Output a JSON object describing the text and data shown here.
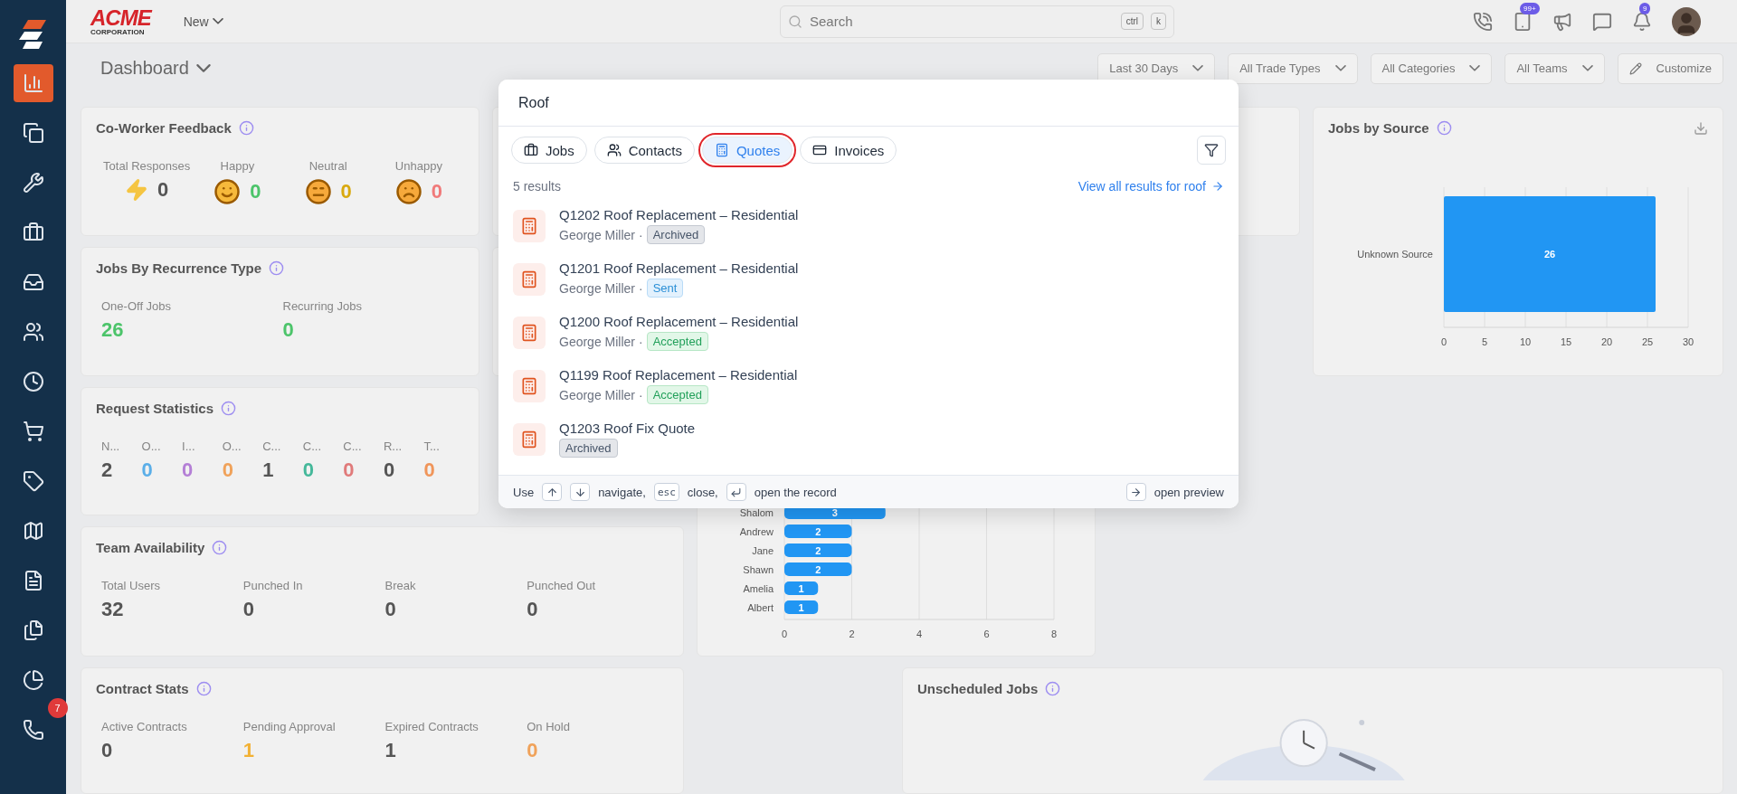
{
  "sidebar": {
    "items": [
      {
        "selected": true
      },
      {
        "selected": false
      },
      {
        "selected": false
      },
      {
        "selected": false
      },
      {
        "selected": false
      },
      {
        "selected": false
      },
      {
        "selected": false
      },
      {
        "selected": false
      },
      {
        "selected": false
      },
      {
        "selected": false
      },
      {
        "selected": false
      },
      {
        "selected": false
      },
      {
        "selected": false
      },
      {
        "selected": false,
        "badge": "7"
      }
    ]
  },
  "top_bar": {
    "logo": "ACME",
    "logo_sub": "CORPORATION",
    "new_menu": "New",
    "search": {
      "placeholder": "Search",
      "keys": [
        "ctrl",
        "k"
      ]
    },
    "badges": {
      "tasks": "99+",
      "notifications": "9"
    }
  },
  "header": {
    "title": "Dashboard",
    "filters": [
      "Last 30 Days",
      "All Trade Types",
      "All Categories",
      "All Teams"
    ],
    "customize": "Customize"
  },
  "coworker_feedback": {
    "title": "Co-Worker Feedback",
    "metrics": [
      {
        "label": "Total Responses",
        "value": "0",
        "kind": "bolt",
        "color": "#555555"
      },
      {
        "label": "Happy",
        "value": "0",
        "kind": "happy",
        "color": "#4cc46a"
      },
      {
        "label": "Neutral",
        "value": "0",
        "kind": "neutral",
        "color": "#d9a90f"
      },
      {
        "label": "Unhappy",
        "value": "0",
        "kind": "unhappy",
        "color": "#f07a7a"
      }
    ]
  },
  "recurrence": {
    "title": "Jobs By Recurrence Type",
    "metrics": [
      {
        "label": "One-Off Jobs",
        "value": "26",
        "color": "#4cc46a"
      },
      {
        "label": "Recurring Jobs",
        "value": "0",
        "color": "#4cc46a"
      }
    ]
  },
  "request_statistics": {
    "title": "Request Statistics",
    "metrics": [
      {
        "label": "N...",
        "value": "2",
        "color": "#555555"
      },
      {
        "label": "O...",
        "value": "0",
        "color": "#5aaee8"
      },
      {
        "label": "I...",
        "value": "0",
        "color": "#b47fd6"
      },
      {
        "label": "O...",
        "value": "0",
        "color": "#f0a25a"
      },
      {
        "label": "C...",
        "value": "1",
        "color": "#555555"
      },
      {
        "label": "C...",
        "value": "0",
        "color": "#45b89a"
      },
      {
        "label": "C...",
        "value": "0",
        "color": "#e07a7a"
      },
      {
        "label": "R...",
        "value": "0",
        "color": "#555555"
      },
      {
        "label": "T...",
        "value": "0",
        "color": "#f0955a"
      }
    ]
  },
  "team_availability": {
    "title": "Team Availability",
    "metrics": [
      {
        "label": "Total Users",
        "value": "32",
        "color": "#555555"
      },
      {
        "label": "Punched In",
        "value": "0",
        "color": "#555555"
      },
      {
        "label": "Break",
        "value": "0",
        "color": "#555555"
      },
      {
        "label": "Punched Out",
        "value": "0",
        "color": "#555555"
      }
    ]
  },
  "contract_stats": {
    "title": "Contract Stats",
    "metrics": [
      {
        "label": "Active Contracts",
        "value": "0",
        "color": "#555555"
      },
      {
        "label": "Pending Approval",
        "value": "1",
        "color": "#f2b134"
      },
      {
        "label": "Expired Contracts",
        "value": "1",
        "color": "#555555"
      },
      {
        "label": "On Hold",
        "value": "0",
        "color": "#f0a25a"
      }
    ]
  },
  "jobs_by_source": {
    "title": "Jobs by Source",
    "chart_data": {
      "type": "bar",
      "orientation": "horizontal",
      "categories": [
        "Unknown Source"
      ],
      "values": [
        26
      ],
      "xlim": [
        0,
        30
      ],
      "xticks": [
        0,
        5,
        10,
        15,
        20,
        25,
        30
      ],
      "grid": true,
      "data_labels": true
    }
  },
  "team_jobs": {
    "chart_data": {
      "type": "bar",
      "orientation": "horizontal",
      "categories": [
        "Shalom",
        "Andrew",
        "Jane",
        "Shawn",
        "Amelia",
        "Albert"
      ],
      "values": [
        3,
        2,
        2,
        2,
        1,
        1
      ],
      "xlim": [
        0,
        8
      ],
      "xticks": [
        0,
        2,
        4,
        6,
        8
      ],
      "grid": true,
      "data_labels": true
    }
  },
  "unscheduled_jobs": {
    "title": "Unscheduled Jobs"
  },
  "search_modal": {
    "query": "Roof",
    "tabs": [
      {
        "label": "Jobs",
        "kind": "jobs",
        "selected": false
      },
      {
        "label": "Contacts",
        "kind": "contacts",
        "selected": false
      },
      {
        "label": "Quotes",
        "kind": "quotes",
        "selected": true
      },
      {
        "label": "Invoices",
        "kind": "invoices",
        "selected": false
      }
    ],
    "results_count": "5 results",
    "view_all": "View all results for roof",
    "results": [
      {
        "title": "Q1202 Roof Replacement – Residential",
        "owner": "George Miller",
        "separator": "·",
        "status": {
          "label": "Archived",
          "kind": "archived"
        }
      },
      {
        "title": "Q1201 Roof Replacement – Residential",
        "owner": "George Miller",
        "separator": "·",
        "status": {
          "label": "Sent",
          "kind": "sent"
        }
      },
      {
        "title": "Q1200 Roof Replacement – Residential",
        "owner": "George Miller",
        "separator": "·",
        "status": {
          "label": "Accepted",
          "kind": "accepted"
        }
      },
      {
        "title": "Q1199 Roof Replacement – Residential",
        "owner": "George Miller",
        "separator": "·",
        "status": {
          "label": "Accepted",
          "kind": "accepted"
        }
      },
      {
        "title": "Q1203 Roof Fix Quote",
        "status": {
          "label": "Archived",
          "kind": "archived"
        }
      }
    ],
    "footer": {
      "use": "Use",
      "navigate": "navigate,",
      "esc": "esc",
      "close": "close,",
      "open_record": "open the record",
      "open_preview": "open preview"
    }
  }
}
